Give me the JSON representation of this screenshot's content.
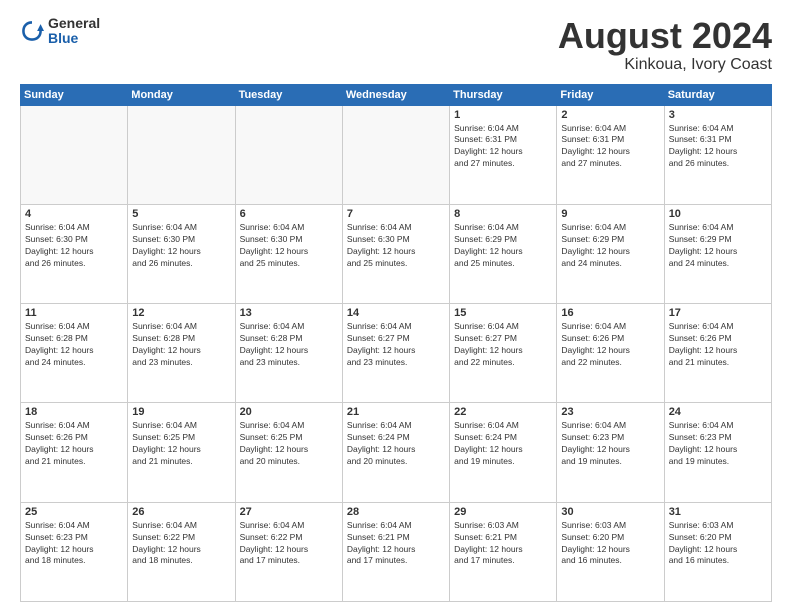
{
  "header": {
    "logo_general": "General",
    "logo_blue": "Blue",
    "title": "August 2024",
    "location": "Kinkoua, Ivory Coast"
  },
  "weekdays": [
    "Sunday",
    "Monday",
    "Tuesday",
    "Wednesday",
    "Thursday",
    "Friday",
    "Saturday"
  ],
  "weeks": [
    [
      {
        "day": "",
        "info": ""
      },
      {
        "day": "",
        "info": ""
      },
      {
        "day": "",
        "info": ""
      },
      {
        "day": "",
        "info": ""
      },
      {
        "day": "1",
        "info": "Sunrise: 6:04 AM\nSunset: 6:31 PM\nDaylight: 12 hours\nand 27 minutes."
      },
      {
        "day": "2",
        "info": "Sunrise: 6:04 AM\nSunset: 6:31 PM\nDaylight: 12 hours\nand 27 minutes."
      },
      {
        "day": "3",
        "info": "Sunrise: 6:04 AM\nSunset: 6:31 PM\nDaylight: 12 hours\nand 26 minutes."
      }
    ],
    [
      {
        "day": "4",
        "info": "Sunrise: 6:04 AM\nSunset: 6:30 PM\nDaylight: 12 hours\nand 26 minutes."
      },
      {
        "day": "5",
        "info": "Sunrise: 6:04 AM\nSunset: 6:30 PM\nDaylight: 12 hours\nand 26 minutes."
      },
      {
        "day": "6",
        "info": "Sunrise: 6:04 AM\nSunset: 6:30 PM\nDaylight: 12 hours\nand 25 minutes."
      },
      {
        "day": "7",
        "info": "Sunrise: 6:04 AM\nSunset: 6:30 PM\nDaylight: 12 hours\nand 25 minutes."
      },
      {
        "day": "8",
        "info": "Sunrise: 6:04 AM\nSunset: 6:29 PM\nDaylight: 12 hours\nand 25 minutes."
      },
      {
        "day": "9",
        "info": "Sunrise: 6:04 AM\nSunset: 6:29 PM\nDaylight: 12 hours\nand 24 minutes."
      },
      {
        "day": "10",
        "info": "Sunrise: 6:04 AM\nSunset: 6:29 PM\nDaylight: 12 hours\nand 24 minutes."
      }
    ],
    [
      {
        "day": "11",
        "info": "Sunrise: 6:04 AM\nSunset: 6:28 PM\nDaylight: 12 hours\nand 24 minutes."
      },
      {
        "day": "12",
        "info": "Sunrise: 6:04 AM\nSunset: 6:28 PM\nDaylight: 12 hours\nand 23 minutes."
      },
      {
        "day": "13",
        "info": "Sunrise: 6:04 AM\nSunset: 6:28 PM\nDaylight: 12 hours\nand 23 minutes."
      },
      {
        "day": "14",
        "info": "Sunrise: 6:04 AM\nSunset: 6:27 PM\nDaylight: 12 hours\nand 23 minutes."
      },
      {
        "day": "15",
        "info": "Sunrise: 6:04 AM\nSunset: 6:27 PM\nDaylight: 12 hours\nand 22 minutes."
      },
      {
        "day": "16",
        "info": "Sunrise: 6:04 AM\nSunset: 6:26 PM\nDaylight: 12 hours\nand 22 minutes."
      },
      {
        "day": "17",
        "info": "Sunrise: 6:04 AM\nSunset: 6:26 PM\nDaylight: 12 hours\nand 21 minutes."
      }
    ],
    [
      {
        "day": "18",
        "info": "Sunrise: 6:04 AM\nSunset: 6:26 PM\nDaylight: 12 hours\nand 21 minutes."
      },
      {
        "day": "19",
        "info": "Sunrise: 6:04 AM\nSunset: 6:25 PM\nDaylight: 12 hours\nand 21 minutes."
      },
      {
        "day": "20",
        "info": "Sunrise: 6:04 AM\nSunset: 6:25 PM\nDaylight: 12 hours\nand 20 minutes."
      },
      {
        "day": "21",
        "info": "Sunrise: 6:04 AM\nSunset: 6:24 PM\nDaylight: 12 hours\nand 20 minutes."
      },
      {
        "day": "22",
        "info": "Sunrise: 6:04 AM\nSunset: 6:24 PM\nDaylight: 12 hours\nand 19 minutes."
      },
      {
        "day": "23",
        "info": "Sunrise: 6:04 AM\nSunset: 6:23 PM\nDaylight: 12 hours\nand 19 minutes."
      },
      {
        "day": "24",
        "info": "Sunrise: 6:04 AM\nSunset: 6:23 PM\nDaylight: 12 hours\nand 19 minutes."
      }
    ],
    [
      {
        "day": "25",
        "info": "Sunrise: 6:04 AM\nSunset: 6:23 PM\nDaylight: 12 hours\nand 18 minutes."
      },
      {
        "day": "26",
        "info": "Sunrise: 6:04 AM\nSunset: 6:22 PM\nDaylight: 12 hours\nand 18 minutes."
      },
      {
        "day": "27",
        "info": "Sunrise: 6:04 AM\nSunset: 6:22 PM\nDaylight: 12 hours\nand 17 minutes."
      },
      {
        "day": "28",
        "info": "Sunrise: 6:04 AM\nSunset: 6:21 PM\nDaylight: 12 hours\nand 17 minutes."
      },
      {
        "day": "29",
        "info": "Sunrise: 6:03 AM\nSunset: 6:21 PM\nDaylight: 12 hours\nand 17 minutes."
      },
      {
        "day": "30",
        "info": "Sunrise: 6:03 AM\nSunset: 6:20 PM\nDaylight: 12 hours\nand 16 minutes."
      },
      {
        "day": "31",
        "info": "Sunrise: 6:03 AM\nSunset: 6:20 PM\nDaylight: 12 hours\nand 16 minutes."
      }
    ]
  ]
}
